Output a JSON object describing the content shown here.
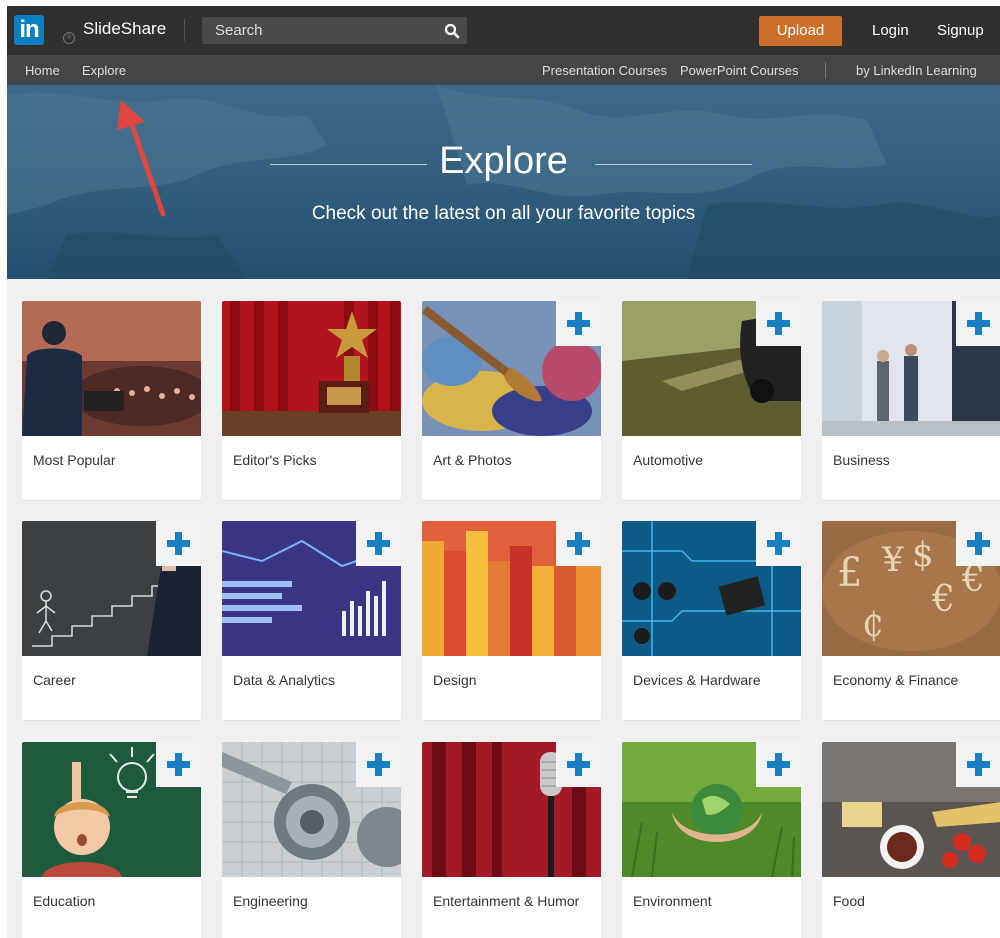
{
  "header": {
    "logo_text": "in",
    "brand": "SlideShare",
    "search_placeholder": "Search",
    "upload": "Upload",
    "login": "Login",
    "signup": "Signup"
  },
  "subnav": {
    "home": "Home",
    "explore": "Explore",
    "presentation_courses": "Presentation Courses",
    "powerpoint_courses": "PowerPoint Courses",
    "linkedin_learning": "by LinkedIn Learning"
  },
  "hero": {
    "title": "Explore",
    "subtitle": "Check out the latest on all your favorite topics"
  },
  "categories": [
    {
      "label": "Most Popular",
      "icon": "presentation-photo",
      "followable": false
    },
    {
      "label": "Editor's Picks",
      "icon": "trophy-photo",
      "followable": false
    },
    {
      "label": "Art & Photos",
      "icon": "paintbrush-photo",
      "followable": true
    },
    {
      "label": "Automotive",
      "icon": "car-photo",
      "followable": true
    },
    {
      "label": "Business",
      "icon": "business-people-photo",
      "followable": true
    },
    {
      "label": "Career",
      "icon": "chalk-stairs-photo",
      "followable": true
    },
    {
      "label": "Data & Analytics",
      "icon": "analytics-chart-photo",
      "followable": true
    },
    {
      "label": "Design",
      "icon": "color-bars-photo",
      "followable": true
    },
    {
      "label": "Devices & Hardware",
      "icon": "circuit-board-photo",
      "followable": true
    },
    {
      "label": "Economy & Finance",
      "icon": "currency-symbols-photo",
      "followable": true
    },
    {
      "label": "Education",
      "icon": "child-chalkboard-photo",
      "followable": true
    },
    {
      "label": "Engineering",
      "icon": "gear-caliper-photo",
      "followable": true
    },
    {
      "label": "Entertainment & Humor",
      "icon": "microphone-photo",
      "followable": true
    },
    {
      "label": "Environment",
      "icon": "earth-hands-photo",
      "followable": true
    },
    {
      "label": "Food",
      "icon": "food-table-photo",
      "followable": true
    }
  ],
  "colors": {
    "topbar": "#303030",
    "subnav": "#454545",
    "upload_button": "#cc6f2a",
    "linkedin_blue": "#0a7fc2",
    "plus_blue": "#1a7fc1",
    "hero": "#2f5b7b",
    "annotation_arrow": "#e0463f"
  }
}
